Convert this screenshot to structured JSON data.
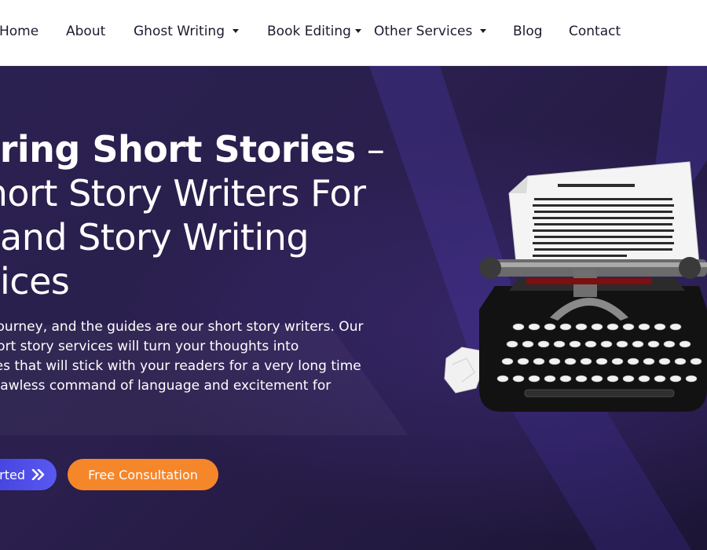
{
  "nav": {
    "items": [
      {
        "label": "Home",
        "dropdown": false
      },
      {
        "label": "About",
        "dropdown": false
      },
      {
        "label": "Ghost Writing",
        "dropdown": true
      },
      {
        "label": "Book Editing",
        "dropdown": true
      },
      {
        "label": "Other Services",
        "dropdown": true
      },
      {
        "label": "Blog",
        "dropdown": false
      },
      {
        "label": "Contact",
        "dropdown": false
      }
    ]
  },
  "hero": {
    "title_line1_bold": "piring Short Stories",
    "title_line1_dash": " –",
    "title_line2": " Short Story Writers For",
    "title_line3": "and Story Writing",
    "title_line4": "ices",
    "description_lines": [
      "is a journey, and the guides are our short story writers. Our",
      "al short story services will turn your thoughts into",
      "stories that will stick with your readers for a very long time",
      "our flawless command of language and excitement for"
    ],
    "get_started_label": "rted",
    "get_started_icon": "double-chevron-right-icon",
    "free_consultation_label": "Free Consultation"
  },
  "colors": {
    "nav_bg": "#ffffff",
    "hero_bg": "#2a1f4d",
    "accent_blue": "#4b4ae8",
    "accent_orange": "#f6862a",
    "text_white": "#ffffff"
  }
}
